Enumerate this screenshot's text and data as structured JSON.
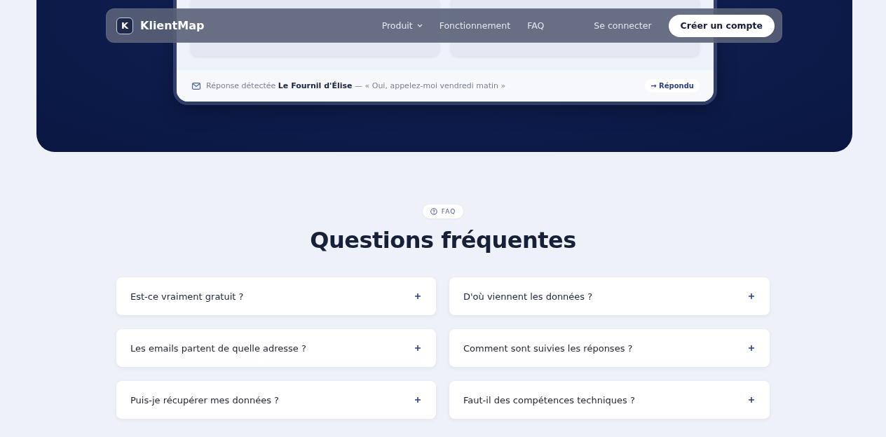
{
  "nav": {
    "logo_letter": "K",
    "brand": "KlientMap",
    "links": [
      {
        "label": "Produit",
        "dropdown": true
      },
      {
        "label": "Fonctionnement",
        "dropdown": false
      },
      {
        "label": "FAQ",
        "dropdown": false
      }
    ],
    "login": "Se connecter",
    "cta": "Créer un compte"
  },
  "preview": {
    "notice": {
      "label": "Réponse détectée",
      "company": "Le Fournil d'Élise",
      "quote": "— « Oui, appelez-moi vendredi matin »",
      "status": "→ Répondu"
    }
  },
  "faq": {
    "badge": "FAQ",
    "title": "Questions fréquentes",
    "items": [
      {
        "question": "Est-ce vraiment gratuit ?",
        "expanded": false
      },
      {
        "question": "D'où viennent les données ?",
        "expanded": false
      },
      {
        "question": "Les emails partent de quelle adresse ?",
        "expanded": false
      },
      {
        "question": "Comment sont suivies les réponses ?",
        "expanded": false
      },
      {
        "question": "Puis-je récupérer mes données ?",
        "expanded": false
      },
      {
        "question": "Faut-il des compétences techniques ?",
        "expanded": false
      }
    ]
  }
}
